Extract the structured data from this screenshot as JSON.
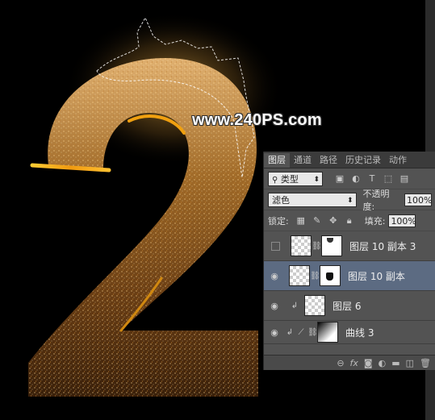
{
  "watermark": "www.240PS.com",
  "panel": {
    "tabs": [
      "图层",
      "通道",
      "路径",
      "历史记录",
      "动作"
    ],
    "filter_kind": "类型",
    "blend_mode": "滤色",
    "opacity_label": "不透明度:",
    "opacity_value": "100%",
    "lock_label": "锁定:",
    "fill_label": "填充:",
    "fill_value": "100%",
    "layers": [
      {
        "name": "图层 10 副本 3",
        "visible": false,
        "selected": false
      },
      {
        "name": "图层 10 副本",
        "visible": true,
        "selected": true
      },
      {
        "name": "图层 6",
        "visible": true,
        "selected": false
      },
      {
        "name": "曲线 3",
        "visible": true,
        "selected": false
      }
    ],
    "bottom_icons": [
      "link-icon",
      "fx-icon",
      "mask-icon",
      "adjustment-icon",
      "folder-icon",
      "new-layer-icon",
      "trash-icon"
    ],
    "fx_label": "fx"
  },
  "colors": {
    "panel_bg": "#535353",
    "selected_row": "#5c6b82",
    "gold": "#f0a010"
  }
}
